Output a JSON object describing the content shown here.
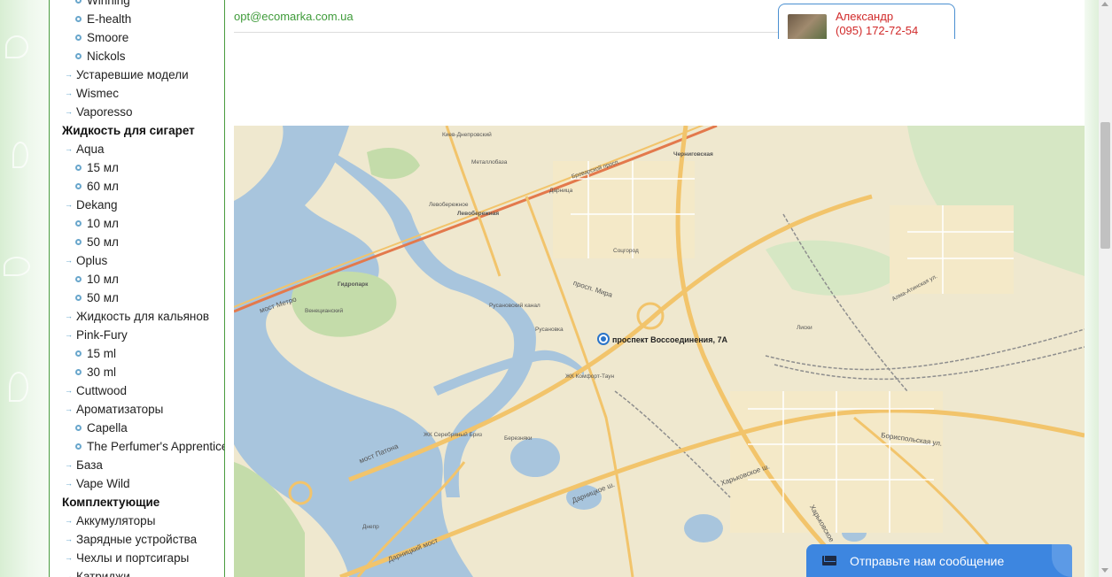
{
  "sidebar": {
    "items": [
      {
        "label": "Winning",
        "level": 2
      },
      {
        "label": "E-health",
        "level": 2
      },
      {
        "label": "Smoore",
        "level": 2
      },
      {
        "label": "Nickols",
        "level": 2
      },
      {
        "label": "Устаревшие модели",
        "level": 1
      },
      {
        "label": "Wismec",
        "level": 1
      },
      {
        "label": "Vaporesso",
        "level": 1
      },
      {
        "label": "Жидкость для сигарет",
        "level": 0
      },
      {
        "label": "Aqua",
        "level": 1
      },
      {
        "label": "15 мл",
        "level": 2
      },
      {
        "label": "60 мл",
        "level": 2
      },
      {
        "label": "Dekang",
        "level": 1
      },
      {
        "label": "10 мл",
        "level": 2
      },
      {
        "label": "50 мл",
        "level": 2
      },
      {
        "label": "Oplus",
        "level": 1
      },
      {
        "label": "10 мл",
        "level": 2
      },
      {
        "label": "50 мл",
        "level": 2
      },
      {
        "label": "Жидкость для кальянов",
        "level": 1
      },
      {
        "label": "Pink-Fury",
        "level": 1
      },
      {
        "label": "15 ml",
        "level": 2
      },
      {
        "label": "30 ml",
        "level": 2
      },
      {
        "label": "Cuttwood",
        "level": 1
      },
      {
        "label": "Ароматизаторы",
        "level": 1
      },
      {
        "label": "Capella",
        "level": 2
      },
      {
        "label": "The Perfumer's Apprentice",
        "level": 2
      },
      {
        "label": "База",
        "level": 1
      },
      {
        "label": "Vape Wild",
        "level": 1
      },
      {
        "label": "Комплектующие",
        "level": 0
      },
      {
        "label": "Аккумуляторы",
        "level": 1
      },
      {
        "label": "Зарядные устройства",
        "level": 1
      },
      {
        "label": "Чехлы и портсигары",
        "level": 1
      },
      {
        "label": "Катриджи",
        "level": 1
      }
    ]
  },
  "header": {
    "email": "opt@ecomarka.com.ua"
  },
  "contact": {
    "name": "Александр",
    "phone": "(095) 172-72-54"
  },
  "map": {
    "address": "проспект Воссоединения, 7А",
    "labels": [
      {
        "text": "Киев-Днепровский"
      },
      {
        "text": "Металлобаза"
      },
      {
        "text": "Дарница"
      },
      {
        "text": "Левобережное"
      },
      {
        "text": "Левобережная"
      },
      {
        "text": "Черниговская"
      },
      {
        "text": "Броварской просп."
      },
      {
        "text": "Гидропарк"
      },
      {
        "text": "мост Метро"
      },
      {
        "text": "Венецианский"
      },
      {
        "text": "Соцгород"
      },
      {
        "text": "просп. Мира"
      },
      {
        "text": "Русановка"
      },
      {
        "text": "ЖК Комфорт-Таун"
      },
      {
        "text": "Русановский канал"
      },
      {
        "text": "ЖК Серебряный Бриз"
      },
      {
        "text": "Березняки"
      },
      {
        "text": "мост Патона"
      },
      {
        "text": "Дарницкий мост"
      },
      {
        "text": "Харьковское ш."
      },
      {
        "text": "Харьковское"
      },
      {
        "text": "Дарницкое ш."
      },
      {
        "text": "Бориспольская ул."
      },
      {
        "text": "Днепр"
      },
      {
        "text": "Лиски"
      },
      {
        "text": "Алма-Атинская ул."
      }
    ]
  },
  "chat": {
    "label": "Отправьте нам сообщение"
  },
  "colors": {
    "sidebar_border": "#4a9b3f",
    "email": "#3f9b3a",
    "contact": "#d12a2a",
    "chat": "#3d86e0",
    "water": "#a8c5dd",
    "park": "#c4dcaa",
    "road": "#f2c46b"
  }
}
